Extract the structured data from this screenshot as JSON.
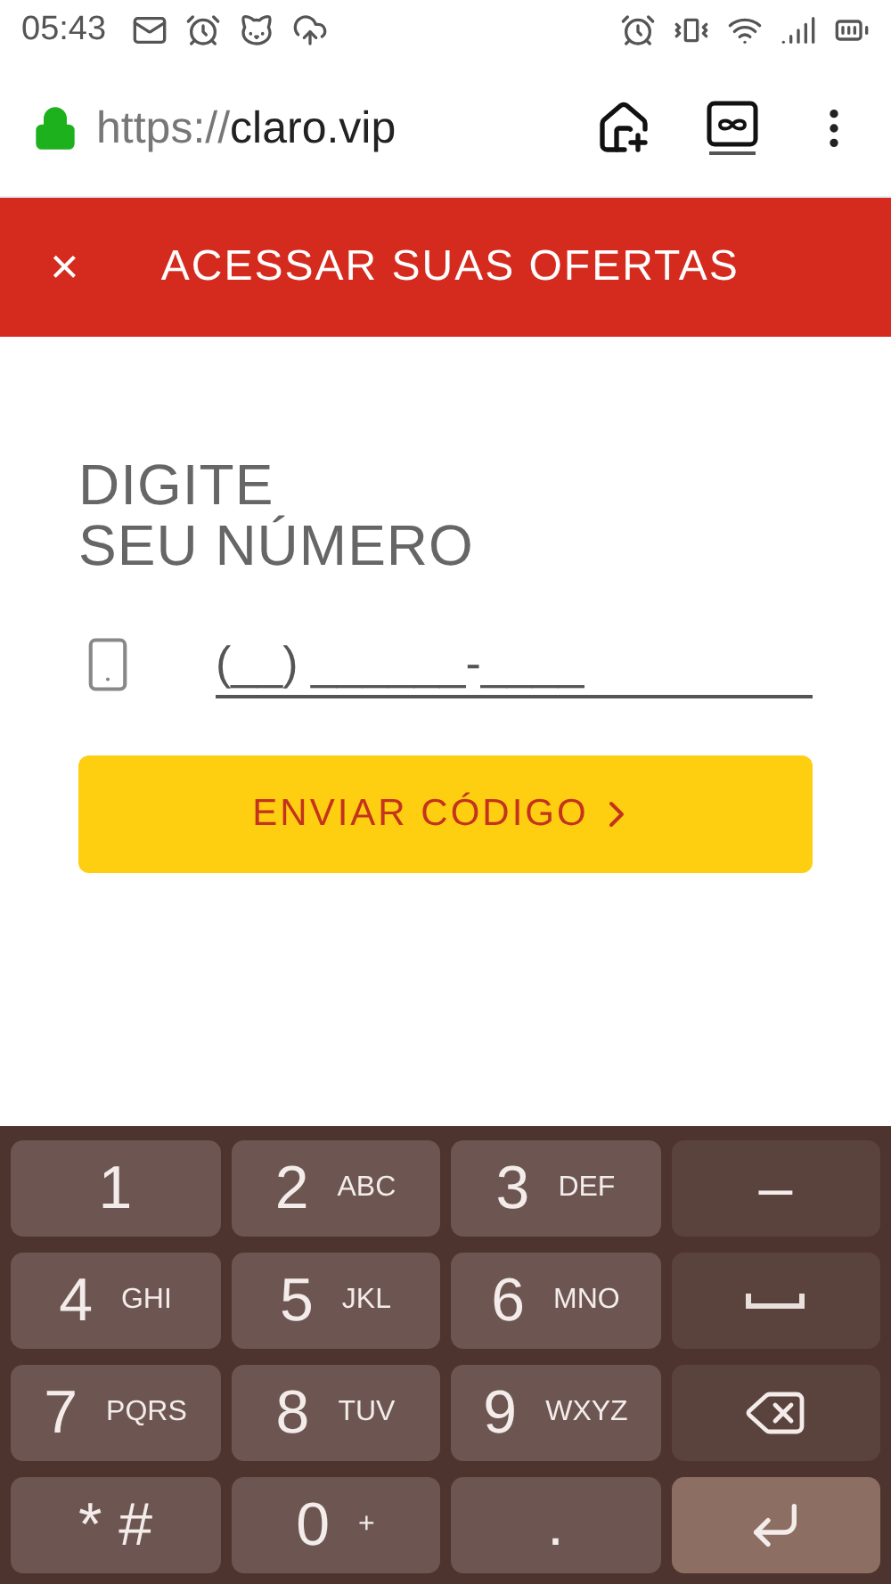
{
  "status_bar": {
    "time": "05:43"
  },
  "browser": {
    "url_scheme": "https://",
    "url_host": "claro.vip"
  },
  "header": {
    "close": "×",
    "title": "ACESSAR SUAS OFERTAS"
  },
  "form": {
    "heading_lines": [
      "DIGITE",
      "SEU NÚMERO"
    ],
    "phone_field": {
      "placeholder": "(__) ______-____"
    },
    "submit": "ENVIAR CÓDIGO"
  },
  "keyboard": {
    "rows": [
      [
        {
          "kind": "char",
          "main": "1"
        },
        {
          "kind": "char",
          "main": "2",
          "sub": "ABC"
        },
        {
          "kind": "char",
          "main": "3",
          "sub": "DEF"
        },
        {
          "kind": "action",
          "main": "–"
        }
      ],
      [
        {
          "kind": "char",
          "main": "4",
          "sub": "GHI"
        },
        {
          "kind": "char",
          "main": "5",
          "sub": "JKL"
        },
        {
          "kind": "char",
          "main": "6",
          "sub": "MNO"
        },
        {
          "kind": "space"
        }
      ],
      [
        {
          "kind": "char",
          "main": "7",
          "sub": "PQRS"
        },
        {
          "kind": "char",
          "main": "8",
          "sub": "TUV"
        },
        {
          "kind": "char",
          "main": "9",
          "sub": "WXYZ"
        },
        {
          "kind": "backspace"
        }
      ],
      [
        {
          "kind": "char",
          "main": "* #"
        },
        {
          "kind": "char",
          "main": "0",
          "sub": "+"
        },
        {
          "kind": "char",
          "main": "."
        },
        {
          "kind": "enter"
        }
      ]
    ]
  }
}
